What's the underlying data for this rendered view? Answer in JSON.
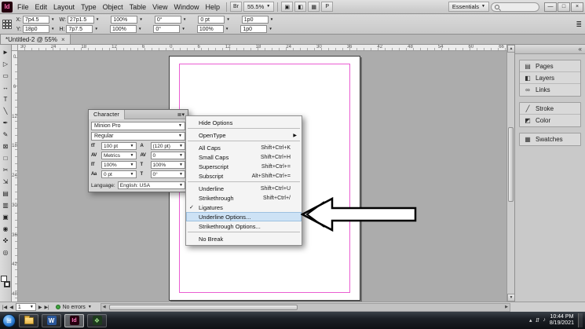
{
  "titlebar": {
    "logo": "Id",
    "menus": [
      "File",
      "Edit",
      "Layout",
      "Type",
      "Object",
      "Table",
      "View",
      "Window",
      "Help"
    ],
    "bridge_label": "Br",
    "zoom": "55.5%",
    "toolbar_icons": [
      {
        "name": "view-options-icon",
        "glyph": "▣"
      },
      {
        "name": "screen-mode-icon",
        "glyph": "◧"
      },
      {
        "name": "arrange-documents-icon",
        "glyph": "▦"
      },
      {
        "name": "preflight-icon",
        "glyph": "P"
      }
    ],
    "workspace": "Essentials",
    "window_buttons": [
      {
        "name": "minimize-button",
        "glyph": "—"
      },
      {
        "name": "restore-button",
        "glyph": "□"
      },
      {
        "name": "close-button",
        "glyph": "×"
      }
    ]
  },
  "controlbar": {
    "row1": [
      {
        "label": "X:",
        "value": "7p4.5"
      },
      {
        "label": "W:",
        "value": "27p1.5"
      },
      {
        "label": "",
        "value": "100%"
      },
      {
        "label": "",
        "value": "0°"
      },
      {
        "label": "",
        "value": "0 pt"
      },
      {
        "label": "",
        "value": "1p0"
      }
    ],
    "row2": [
      {
        "label": "Y:",
        "value": "18p0"
      },
      {
        "label": "H:",
        "value": "7p7.5"
      },
      {
        "label": "",
        "value": "100%"
      },
      {
        "label": "",
        "value": "0°"
      },
      {
        "label": "",
        "value": "100%"
      },
      {
        "label": "",
        "value": "1p0"
      }
    ],
    "panel_menu": "≣"
  },
  "doctab": {
    "title": "*Untitled-2 @ 55%",
    "close": "×"
  },
  "rulers": {
    "h": [
      "30",
      "24",
      "18",
      "12",
      "6",
      "0",
      "6",
      "12",
      "18",
      "24",
      "30",
      "36",
      "42",
      "48",
      "54",
      "60",
      "66"
    ],
    "v": [
      "0",
      "6",
      "12",
      "18",
      "24",
      "30",
      "36",
      "42",
      "48"
    ]
  },
  "tools": [
    {
      "name": "selection-tool",
      "glyph": "►"
    },
    {
      "name": "direct-selection-tool",
      "glyph": "▷"
    },
    {
      "name": "page-tool",
      "glyph": "▭"
    },
    {
      "name": "gap-tool",
      "glyph": "↔"
    },
    {
      "name": "type-tool",
      "glyph": "T"
    },
    {
      "name": "line-tool",
      "glyph": "╲"
    },
    {
      "name": "pen-tool",
      "glyph": "✒"
    },
    {
      "name": "pencil-tool",
      "glyph": "✎"
    },
    {
      "name": "rectangle-frame-tool",
      "glyph": "⊠"
    },
    {
      "name": "rectangle-tool",
      "glyph": "□"
    },
    {
      "name": "scissors-tool",
      "glyph": "✂"
    },
    {
      "name": "free-transform-tool",
      "glyph": "⇲"
    },
    {
      "name": "gradient-swatch-tool",
      "glyph": "▤"
    },
    {
      "name": "gradient-feather-tool",
      "glyph": "▥"
    },
    {
      "name": "note-tool",
      "glyph": "▣"
    },
    {
      "name": "eyedropper-tool",
      "glyph": "◉"
    },
    {
      "name": "hand-tool",
      "glyph": "✜"
    },
    {
      "name": "zoom-tool",
      "glyph": "◎"
    }
  ],
  "character_panel": {
    "tab": "Character",
    "panel_menu_icon": "≣▾",
    "font_family": "Minion Pro",
    "font_style": "Regular",
    "fields": [
      {
        "name": "font-size-field",
        "icon": "tT",
        "value": "100 pt"
      },
      {
        "name": "leading-field",
        "icon": "A",
        "value": "(120 pt)"
      },
      {
        "name": "kerning-field",
        "icon": "AV",
        "value": "Metrics"
      },
      {
        "name": "tracking-field",
        "icon": "AV",
        "value": "0"
      },
      {
        "name": "vertical-scale-field",
        "icon": "IT",
        "value": "100%"
      },
      {
        "name": "horizontal-scale-field",
        "icon": "T",
        "value": "100%"
      },
      {
        "name": "baseline-shift-field",
        "icon": "Aa",
        "value": "0 pt"
      },
      {
        "name": "skew-field",
        "icon": "T",
        "value": "0°"
      }
    ],
    "language_label": "Language:",
    "language": "English: USA"
  },
  "context_menu": {
    "items": [
      {
        "name": "menu-item-hide-options",
        "label": "Hide Options",
        "shortcut": "",
        "check": "",
        "submenu": "",
        "sep": true
      },
      {
        "name": "menu-item-opentype",
        "label": "OpenType",
        "shortcut": "",
        "check": "",
        "submenu": "▶",
        "sep": true
      },
      {
        "name": "menu-item-all-caps",
        "label": "All Caps",
        "shortcut": "Shift+Ctrl+K",
        "check": "",
        "submenu": ""
      },
      {
        "name": "menu-item-small-caps",
        "label": "Small Caps",
        "shortcut": "Shift+Ctrl+H",
        "check": "",
        "submenu": ""
      },
      {
        "name": "menu-item-superscript",
        "label": "Superscript",
        "shortcut": "Shift+Ctrl+=",
        "check": "",
        "submenu": ""
      },
      {
        "name": "menu-item-subscript",
        "label": "Subscript",
        "shortcut": "Alt+Shift+Ctrl+=",
        "check": "",
        "submenu": "",
        "sep": true
      },
      {
        "name": "menu-item-underline",
        "label": "Underline",
        "shortcut": "Shift+Ctrl+U",
        "check": "",
        "submenu": ""
      },
      {
        "name": "menu-item-strikethrough",
        "label": "Strikethrough",
        "shortcut": "Shift+Ctrl+/",
        "check": "",
        "submenu": ""
      },
      {
        "name": "menu-item-ligatures",
        "label": "Ligatures",
        "shortcut": "",
        "check": "✓",
        "submenu": ""
      },
      {
        "name": "menu-item-underline-options",
        "label": "Underline Options...",
        "shortcut": "",
        "check": "",
        "submenu": "",
        "highlighted": true
      },
      {
        "name": "menu-item-strikethrough-options",
        "label": "Strikethrough Options...",
        "shortcut": "",
        "check": "",
        "submenu": "",
        "sep": true
      },
      {
        "name": "menu-item-no-break",
        "label": "No Break",
        "shortcut": "",
        "check": "",
        "submenu": ""
      }
    ]
  },
  "right_dock": {
    "collapse_icon": "«",
    "group1": [
      {
        "name": "panel-pages",
        "icon": "▤",
        "label": "Pages"
      },
      {
        "name": "panel-layers",
        "icon": "◧",
        "label": "Layers"
      },
      {
        "name": "panel-links",
        "icon": "∞",
        "label": "Links"
      }
    ],
    "group2": [
      {
        "name": "panel-stroke",
        "icon": "╱",
        "label": "Stroke"
      },
      {
        "name": "panel-color",
        "icon": "◩",
        "label": "Color"
      }
    ],
    "group3": [
      {
        "name": "panel-swatches",
        "icon": "▦",
        "label": "Swatches"
      }
    ]
  },
  "statusbar": {
    "nav_first": "|◀",
    "nav_prev": "◀",
    "page": "1",
    "nav_next": "▶",
    "nav_last": "▶|",
    "errors": "No errors"
  },
  "taskbar": {
    "start_glyph": "⊞",
    "word_label": "W",
    "indesign_label": "Id",
    "app4_glyph": "❖",
    "tray_icons": [
      {
        "name": "hidden-icons-chevron",
        "glyph": "▴"
      },
      {
        "name": "network-icon",
        "glyph": "⇵"
      },
      {
        "name": "volume-icon",
        "glyph": "♪"
      }
    ],
    "time": "10:44 PM",
    "date": "8/19/2021"
  }
}
